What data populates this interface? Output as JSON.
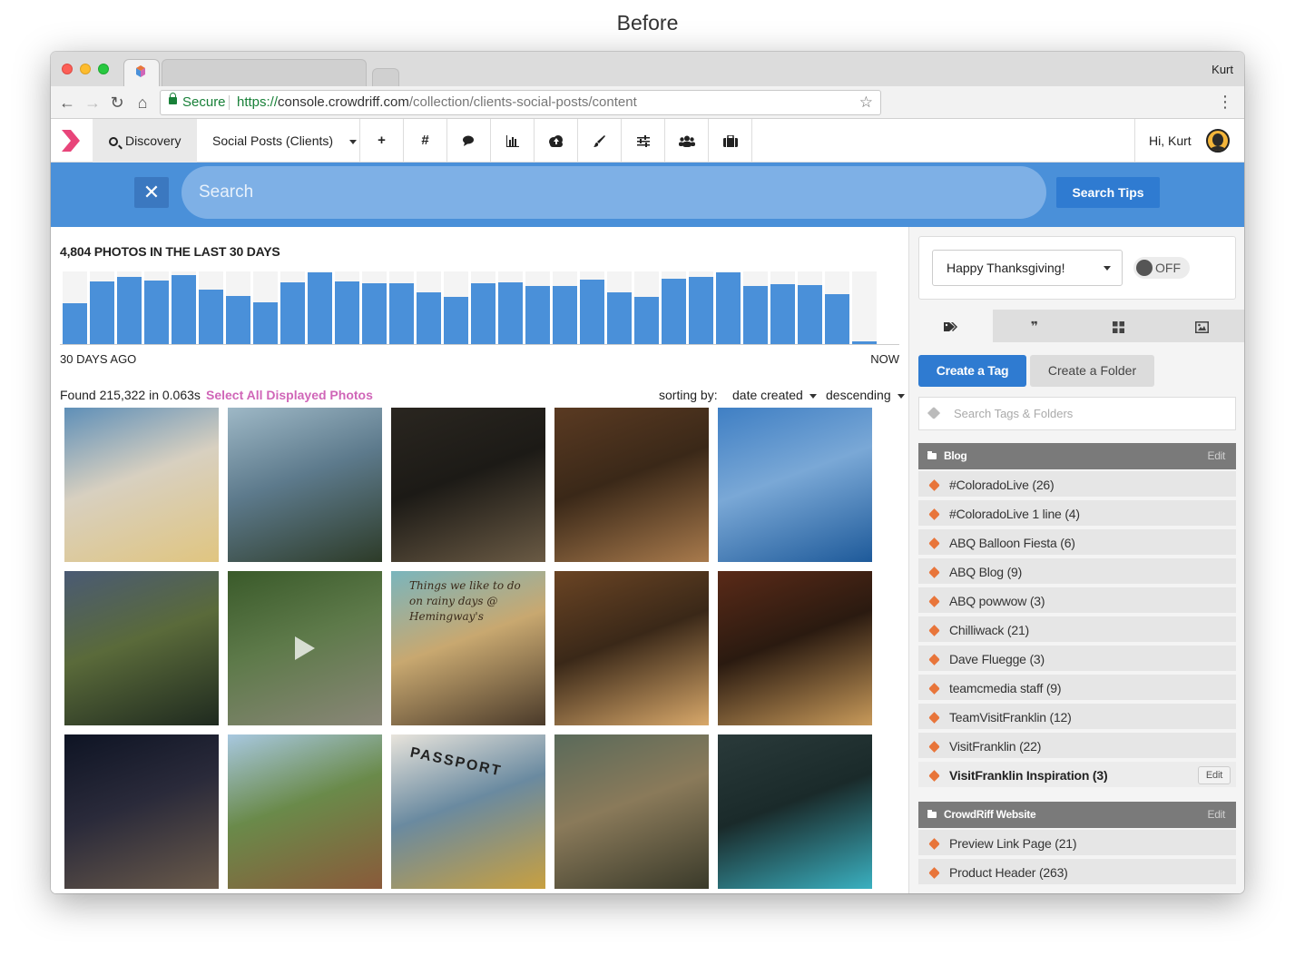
{
  "caption": "Before",
  "browser": {
    "user": "Kurt",
    "secure_label": "Secure",
    "url_scheme": "https://",
    "url_host": "console.crowdriff.com",
    "url_path": "/collection/clients-social-posts/content"
  },
  "nav": {
    "discovery_label": "Discovery",
    "collection_label": "Social Posts (Clients)",
    "icons": [
      "plus-icon",
      "hashtag-icon",
      "comments-icon",
      "bar-chart-icon",
      "cloud-upload-icon",
      "paint-brush-icon",
      "sliders-icon",
      "users-icon",
      "briefcase-icon"
    ],
    "greeting": "Hi, Kurt"
  },
  "search": {
    "placeholder": "Search",
    "tips_label": "Search Tips"
  },
  "histogram": {
    "heading": "4,804 PHOTOS IN THE LAST 30 DAYS",
    "left_label": "30 DAYS AGO",
    "right_label": "NOW",
    "values": [
      45,
      69,
      74,
      70,
      76,
      60,
      53,
      46,
      68,
      79,
      69,
      67,
      67,
      57,
      52,
      67,
      68,
      64,
      64,
      71,
      57,
      52,
      72,
      74,
      79,
      64,
      66,
      65,
      55,
      3
    ]
  },
  "results": {
    "found_text": "Found 215,322 in 0.063s",
    "select_all_label": "Select All Displayed Photos",
    "sorting_label": "sorting by:",
    "sort_field": "date created",
    "sort_order": "descending"
  },
  "photos": {
    "tile_7_text": "Things we like to do on rainy days @ Hemingway's",
    "tile_12_text": "PASSPORT",
    "colors": [
      [
        "#5e8fb8",
        "#e0c580",
        "#d8d0c0"
      ],
      [
        "#9eb8c6",
        "#2d3b28",
        "#5d7a8c"
      ],
      [
        "#2a2620",
        "#6a5a44",
        "#1c1a16"
      ],
      [
        "#5a3a22",
        "#a87a4c",
        "#3a2818"
      ],
      [
        "#3f7fc4",
        "#1e5a9a",
        "#7aa8d6"
      ],
      [
        "#4a5a74",
        "#1f2a1f",
        "#5a6a3a"
      ],
      [
        "#3a5a2a",
        "#8a8678",
        "#5e7a4a"
      ],
      [
        "#7ab5bd",
        "#4a3a2a",
        "#c8a870"
      ],
      [
        "#6a4424",
        "#d8a86a",
        "#3a2818"
      ],
      [
        "#5a2a18",
        "#c89a5a",
        "#2a1a10"
      ],
      [
        "#0e1424",
        "#6a5a4a",
        "#2a2a3a"
      ],
      [
        "#a8c8e0",
        "#8a5a3a",
        "#6a8a4a"
      ],
      [
        "#e8e4dc",
        "#c8a040",
        "#6a8aa0"
      ],
      [
        "#5a6a5a",
        "#3a3a2a",
        "#8a7a5a"
      ],
      [
        "#2a3a3a",
        "#3ab0c0",
        "#1a2a2a"
      ]
    ]
  },
  "panel": {
    "dropdown_value": "Happy Thanksgiving!",
    "toggle_label": "OFF",
    "tabs": [
      "tags-icon",
      "quote-icon",
      "grid-icon",
      "image-icon"
    ],
    "create_tag_label": "Create a Tag",
    "create_folder_label": "Create a Folder",
    "tag_search_placeholder": "Search Tags & Folders",
    "folders": [
      {
        "name": "Blog",
        "edit_label": "Edit",
        "tags": [
          "#ColoradoLive (26)",
          "#ColoradoLive 1 line (4)",
          "ABQ Balloon Fiesta (6)",
          "ABQ Blog (9)",
          "ABQ powwow (3)",
          "Chilliwack (21)",
          "Dave Fluegge (3)",
          "teamcmedia staff (9)",
          "TeamVisitFranklin (12)",
          "VisitFranklin (22)",
          "VisitFranklin Inspiration (3)"
        ],
        "row_edit_label": "Edit"
      },
      {
        "name": "CrowdRiff Website",
        "edit_label": "Edit",
        "tags": [
          "Preview Link Page (21)",
          "Product Header (263)"
        ]
      }
    ]
  }
}
